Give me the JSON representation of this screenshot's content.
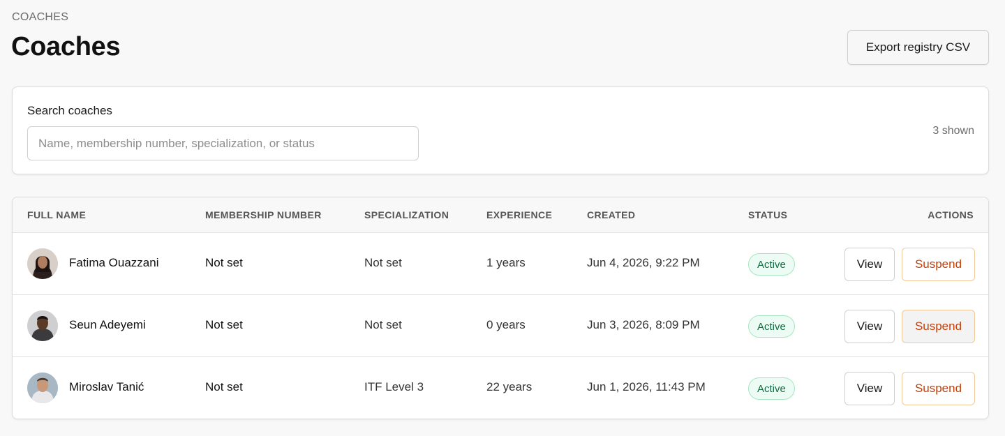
{
  "header": {
    "eyebrow": "COACHES",
    "title": "Coaches",
    "export_label": "Export registry CSV"
  },
  "search": {
    "label": "Search coaches",
    "placeholder": "Name, membership number, specialization, or status",
    "value": "",
    "shown": "3 shown"
  },
  "table": {
    "columns": [
      "FULL NAME",
      "MEMBERSHIP NUMBER",
      "SPECIALIZATION",
      "EXPERIENCE",
      "CREATED",
      "STATUS",
      "ACTIONS"
    ],
    "rows": [
      {
        "name": "Fatima Ouazzani",
        "membership": "Not set",
        "specialization": "Not set",
        "experience": "1 years",
        "created": "Jun 4, 2026, 9:22 PM",
        "status": "Active",
        "view_label": "View",
        "suspend_label": "Suspend",
        "avatar_color": "#3a2a26"
      },
      {
        "name": "Seun Adeyemi",
        "membership": "Not set",
        "specialization": "Not set",
        "experience": "0 years",
        "created": "Jun 3, 2026, 8:09 PM",
        "status": "Active",
        "view_label": "View",
        "suspend_label": "Suspend",
        "avatar_color": "#4a3a30"
      },
      {
        "name": "Miroslav Tanić",
        "membership": "Not set",
        "specialization": "ITF Level 3",
        "experience": "22 years",
        "created": "Jun 1, 2026, 11:43 PM",
        "status": "Active",
        "view_label": "View",
        "suspend_label": "Suspend",
        "avatar_color": "#6b5a4e"
      }
    ]
  },
  "colors": {
    "badge_border": "#a8e6c3",
    "badge_bg": "#ecfbf3",
    "badge_text": "#146c43",
    "suspend_text": "#c2410c",
    "suspend_border": "#f3c99a"
  }
}
